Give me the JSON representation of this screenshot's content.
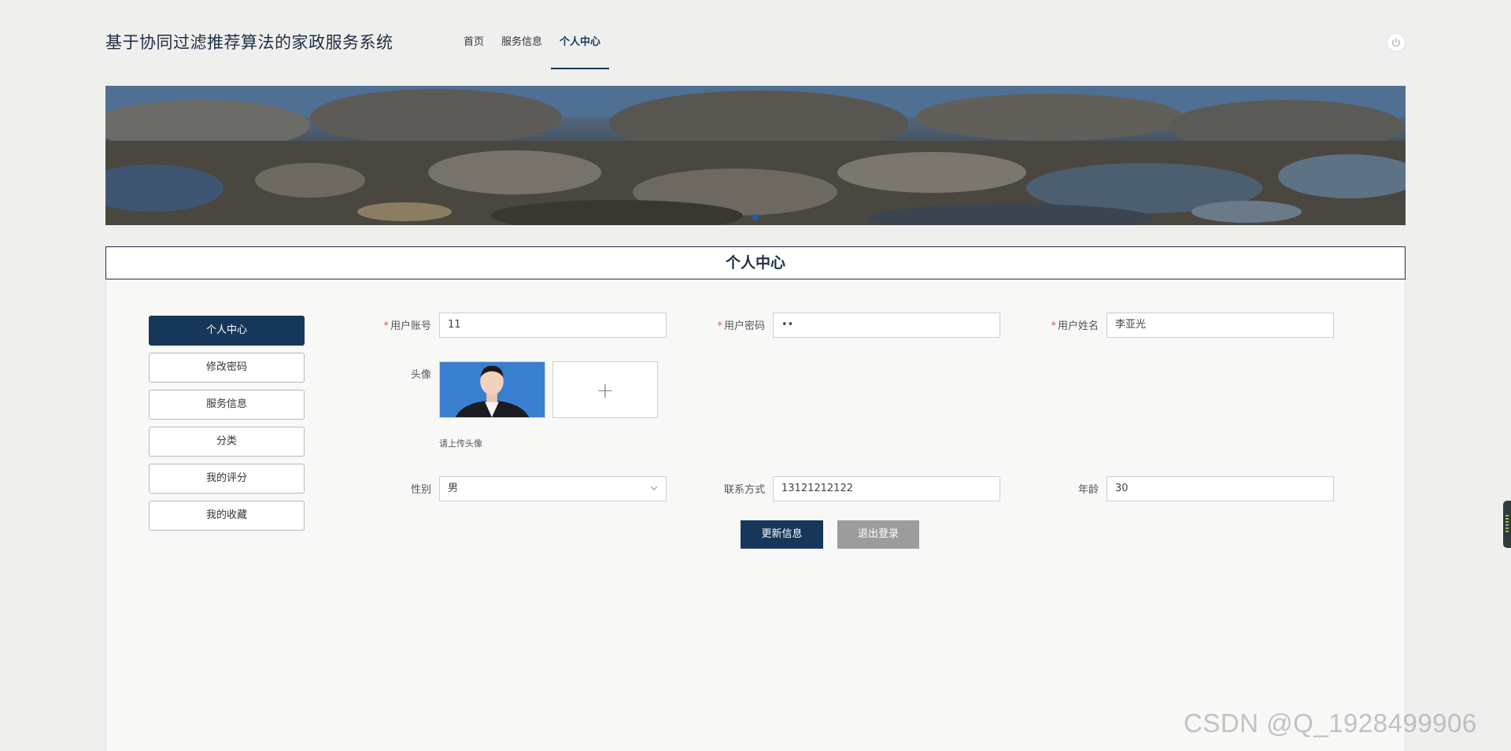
{
  "header": {
    "site_title": "基于协同过滤推荐算法的家政服务系统",
    "nav": [
      {
        "label": "首页",
        "active": false
      },
      {
        "label": "服务信息",
        "active": false
      },
      {
        "label": "个人中心",
        "active": true
      }
    ],
    "power_icon": "power-icon"
  },
  "section": {
    "title": "个人中心"
  },
  "side_menu": {
    "items": [
      {
        "label": "个人中心",
        "active": true
      },
      {
        "label": "修改密码",
        "active": false
      },
      {
        "label": "服务信息",
        "active": false
      },
      {
        "label": "分类",
        "active": false
      },
      {
        "label": "我的评分",
        "active": false
      },
      {
        "label": "我的收藏",
        "active": false
      }
    ]
  },
  "form": {
    "account": {
      "label": "用户账号",
      "required": "*",
      "value": "11"
    },
    "password": {
      "label": "用户密码",
      "required": "*",
      "value": "••"
    },
    "name": {
      "label": "用户姓名",
      "required": "*",
      "value": "李亚光"
    },
    "avatar": {
      "label": "头像",
      "hint": "请上传头像",
      "upload_symbol": "+"
    },
    "gender": {
      "label": "性别",
      "value": "男"
    },
    "phone": {
      "label": "联系方式",
      "value": "13121212122"
    },
    "age": {
      "label": "年龄",
      "value": "30"
    }
  },
  "buttons": {
    "update": "更新信息",
    "logout": "退出登录"
  },
  "watermark": "CSDN @Q_1928499906",
  "colors": {
    "primary": "#17375a",
    "required": "#e05a4d",
    "secondary_button": "#9c9c9c",
    "background": "#efefee"
  }
}
